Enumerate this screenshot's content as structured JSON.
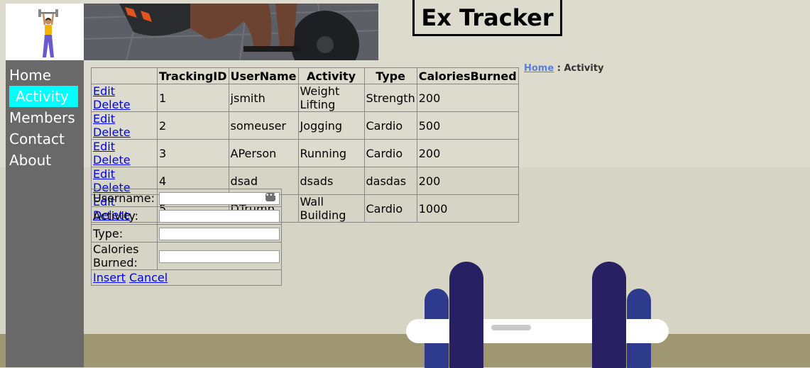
{
  "site": {
    "title": "Ex Tracker"
  },
  "nav": {
    "items": [
      {
        "label": "Home"
      },
      {
        "label": "Activity"
      },
      {
        "label": "Members"
      },
      {
        "label": "Contact"
      },
      {
        "label": "About"
      }
    ],
    "active_index": 1,
    "active_color": "#00ffff"
  },
  "breadcrumb": {
    "home": "Home",
    "separator": " : ",
    "current": "Activity"
  },
  "grid": {
    "headers": [
      "",
      "TrackingID",
      "UserName",
      "Activity",
      "Type",
      "CaloriesBurned"
    ],
    "edit_label": "Edit",
    "delete_label": "Delete",
    "rows": [
      {
        "id": "1",
        "username": "jsmith",
        "activity": "Weight Lifting",
        "type": "Strength",
        "calories": "200"
      },
      {
        "id": "2",
        "username": "someuser",
        "activity": "Jogging",
        "type": "Cardio",
        "calories": "500"
      },
      {
        "id": "3",
        "username": "APerson",
        "activity": "Running",
        "type": "Cardio",
        "calories": "200"
      },
      {
        "id": "4",
        "username": "dsad",
        "activity": "dsads",
        "type": "dasdas",
        "calories": "200"
      },
      {
        "id": "5",
        "username": "DTrump",
        "activity": "Wall Building",
        "type": "Cardio",
        "calories": "1000"
      }
    ]
  },
  "form": {
    "username_label": "Username:",
    "activity_label": "Activity:",
    "type_label": "Type:",
    "calories_label": "Calories Burned:",
    "username_value": "",
    "activity_value": "",
    "type_value": "",
    "calories_value": "",
    "insert_label": "Insert",
    "cancel_label": "Cancel"
  },
  "icons": {
    "logo": "weightlifter-logo",
    "banner": "athlete-barbell-photo",
    "autofill": "more-dots-icon"
  }
}
